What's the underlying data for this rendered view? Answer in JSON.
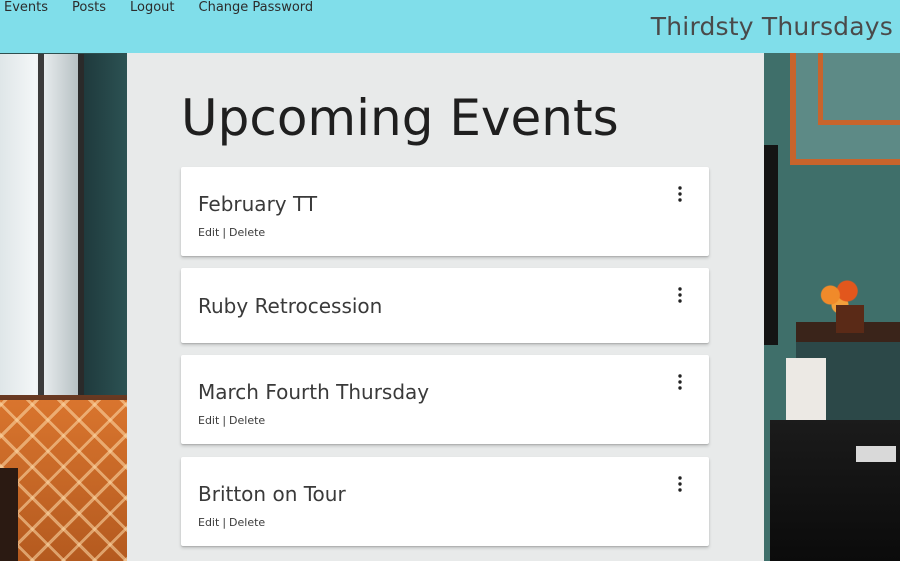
{
  "nav": {
    "links": [
      {
        "label": "Events"
      },
      {
        "label": "Posts"
      },
      {
        "label": "Logout"
      },
      {
        "label": "Change Password"
      }
    ],
    "brand": "Thirdsty Thursdays"
  },
  "page": {
    "title": "Upcoming Events"
  },
  "events": [
    {
      "title": "February TT",
      "edit_label": "Edit",
      "separator": "|",
      "delete_label": "Delete",
      "menu_icon": "more-vert-icon"
    },
    {
      "title": "Ruby Retrocession",
      "menu_icon": "more-vert-icon"
    },
    {
      "title": "March Fourth Thursday",
      "edit_label": "Edit",
      "separator": "|",
      "delete_label": "Delete",
      "menu_icon": "more-vert-icon"
    },
    {
      "title": "Britton on Tour",
      "edit_label": "Edit",
      "separator": "|",
      "delete_label": "Delete",
      "menu_icon": "more-vert-icon"
    }
  ],
  "colors": {
    "navbar": "#80deea",
    "panel": "#f5f5f5",
    "card": "#ffffff",
    "text": "#3a3a3a"
  }
}
